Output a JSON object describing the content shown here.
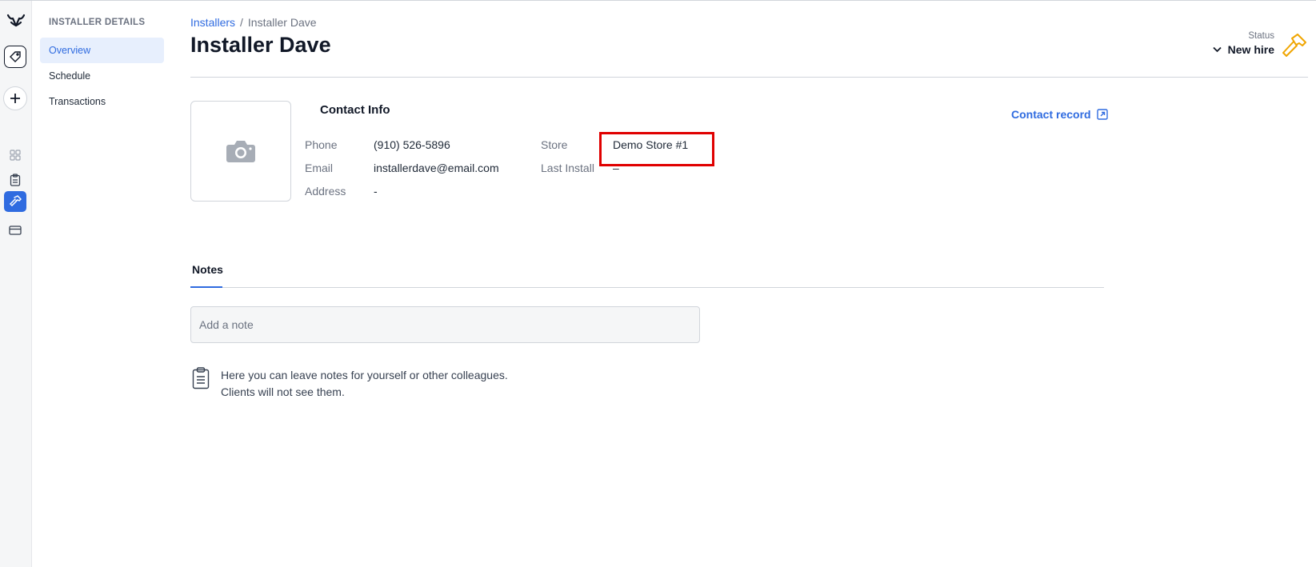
{
  "rail": {
    "icons": [
      "logo-icon",
      "tag-icon",
      "plus-icon",
      "grid-icon",
      "clipboard-icon",
      "hammer-icon",
      "card-icon"
    ],
    "active": "hammer-icon",
    "active_color": "#2f6be0"
  },
  "subnav": {
    "title": "INSTALLER DETAILS",
    "items": [
      {
        "label": "Overview",
        "active": true
      },
      {
        "label": "Schedule",
        "active": false
      },
      {
        "label": "Transactions",
        "active": false
      }
    ]
  },
  "breadcrumb": {
    "parent": "Installers",
    "separator": "/",
    "current": "Installer Dave"
  },
  "page_title": "Installer Dave",
  "status": {
    "label": "Status",
    "value": "New hire",
    "icon": "hammer-icon",
    "icon_color": "#f0a500"
  },
  "contact": {
    "title": "Contact Info",
    "record_link": "Contact record",
    "fields": {
      "phone_label": "Phone",
      "phone_value": "(910) 526-5896",
      "email_label": "Email",
      "email_value": "installerdave@email.com",
      "address_label": "Address",
      "address_value": "-",
      "store_label": "Store",
      "store_value": "Demo Store #1",
      "last_install_label": "Last Install",
      "last_install_value": "–"
    },
    "highlight_color": "#e00000"
  },
  "notes": {
    "tab_label": "Notes",
    "input_placeholder": "Add a note",
    "hint_line1": "Here you can leave notes for yourself or other colleagues.",
    "hint_line2": "Clients will not see them."
  }
}
